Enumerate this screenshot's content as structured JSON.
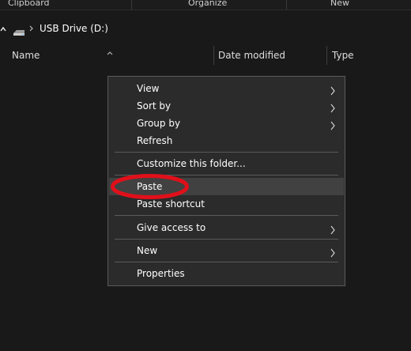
{
  "ribbon": {
    "groups": [
      "Clipboard",
      "Organize",
      "New"
    ]
  },
  "address": {
    "crumb": "USB Drive (D:)"
  },
  "columns": {
    "name": "Name",
    "date_modified": "Date modified",
    "type": "Type"
  },
  "context_menu": {
    "items": [
      {
        "label": "View",
        "submenu": true
      },
      {
        "label": "Sort by",
        "submenu": true
      },
      {
        "label": "Group by",
        "submenu": true
      },
      {
        "label": "Refresh",
        "submenu": false
      },
      {
        "label": "Customize this folder...",
        "submenu": false
      },
      {
        "label": "Paste",
        "submenu": false,
        "highlighted": true
      },
      {
        "label": "Paste shortcut",
        "submenu": false
      },
      {
        "label": "Give access to",
        "submenu": true
      },
      {
        "label": "New",
        "submenu": true
      },
      {
        "label": "Properties",
        "submenu": false
      }
    ]
  },
  "colors": {
    "background": "#191919",
    "menu_background": "#2b2b2b",
    "menu_hover": "#414141",
    "annotation_ring": "#e0101a"
  },
  "icons": {
    "drive": "usb-drive-icon",
    "submenu": "chevron-right-icon",
    "sort": "chevron-up-icon"
  }
}
